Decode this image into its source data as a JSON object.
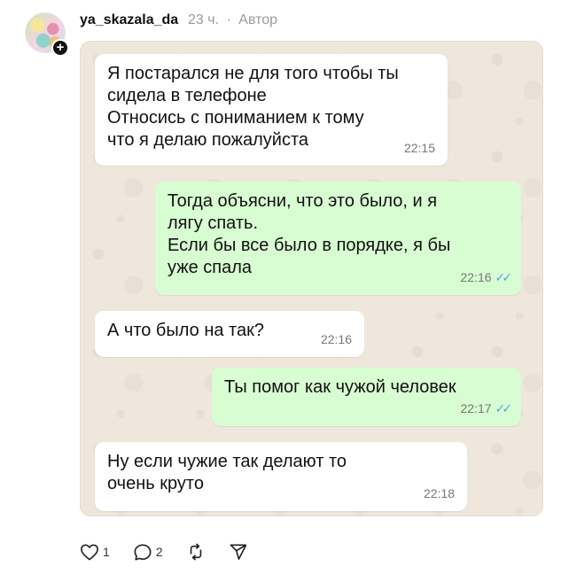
{
  "post": {
    "username": "ya_skazala_da",
    "time_ago": "23 ч.",
    "separator": "·",
    "author_badge": "Автор"
  },
  "messages": [
    {
      "direction": "in",
      "lines": [
        "Я постарался не для того чтобы ты",
        "сидела в телефоне",
        "Относись с пониманием к тому",
        "что я делаю пожалуйста"
      ],
      "time": "22:15"
    },
    {
      "direction": "out",
      "lines": [
        "Тогда объясни, что это было, и я",
        "лягу спать.",
        "Если бы все было в порядке, я бы",
        "уже спала"
      ],
      "time": "22:16",
      "ticks": "✓✓"
    },
    {
      "direction": "in",
      "lines": [
        "А что было на так?"
      ],
      "time": "22:16"
    },
    {
      "direction": "out",
      "lines": [
        "Ты помог как чужой человек"
      ],
      "time": "22:17",
      "ticks": "✓✓"
    },
    {
      "direction": "in",
      "lines": [
        "Ну если чужие так делают то",
        "очень круто"
      ],
      "time": "22:18"
    }
  ],
  "actions": {
    "likes": "1",
    "comments": "2",
    "like_icon": "heart-icon",
    "comment_icon": "comment-icon",
    "repost_icon": "repost-icon",
    "share_icon": "share-icon"
  },
  "colors": {
    "incoming_bubble": "#ffffff",
    "outgoing_bubble": "#d8fdd2",
    "chat_background": "#efe7dc",
    "read_ticks": "#4fa6e8"
  }
}
